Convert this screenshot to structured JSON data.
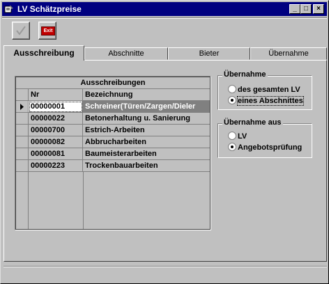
{
  "window": {
    "title": "LV Schätzpreise",
    "controls": [
      "_",
      "□",
      "×"
    ]
  },
  "toolbar": {
    "ok_icon": "checkmark-icon",
    "exit_label": "Exit"
  },
  "tabs": [
    "Ausschreibung",
    "Abschnitte",
    "Bieter",
    "Übernahme"
  ],
  "active_tab": "Ausschreibung",
  "grid": {
    "caption": "Ausschreibungen",
    "columns": [
      "Nr",
      "Bezeichnung"
    ],
    "rows": [
      {
        "nr": "00000001",
        "bez": "Schreiner(Türen/Zargen/Dieler"
      },
      {
        "nr": "00000022",
        "bez": "Betonerhaltung u. Sanierung"
      },
      {
        "nr": "00000700",
        "bez": "Estrich-Arbeiten"
      },
      {
        "nr": "00000082",
        "bez": "Abbrucharbeiten"
      },
      {
        "nr": "00000081",
        "bez": "Baumeisterarbeiten"
      },
      {
        "nr": "00000223",
        "bez": "Trockenbauarbeiten"
      }
    ],
    "selected_row": 0
  },
  "uebernahme": {
    "title": "Übernahme",
    "options": [
      "des gesamten LV",
      "eines Abschnittes"
    ],
    "selected": "eines Abschnittes"
  },
  "uebernahme_aus": {
    "title": "Übernahme aus",
    "options": [
      "LV",
      "Angebotsprüfung"
    ],
    "selected": "Angebotsprüfung"
  },
  "colors": {
    "titlebar": "#000080",
    "face": "#c0c0c0",
    "exit_red": "#c00000"
  }
}
